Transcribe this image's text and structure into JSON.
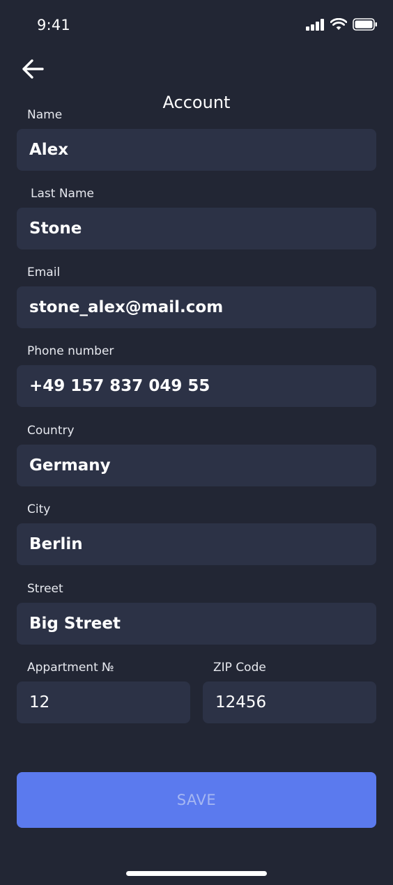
{
  "status_bar": {
    "time": "9:41"
  },
  "header": {
    "title": "Account"
  },
  "form": {
    "name": {
      "label": "Name",
      "value": "Alex"
    },
    "last_name": {
      "label": "Last Name",
      "value": "Stone"
    },
    "email": {
      "label": "Email",
      "value": "stone_alex@mail.com"
    },
    "phone": {
      "label": "Phone number",
      "value": "+49 157 837 049 55"
    },
    "country": {
      "label": "Country",
      "value": "Germany"
    },
    "city": {
      "label": "City",
      "value": "Berlin"
    },
    "street": {
      "label": "Street",
      "value": "Big Street"
    },
    "apartment": {
      "label": "Appartment №",
      "value": "12"
    },
    "zip": {
      "label": "ZIP Code",
      "value": "12456"
    }
  },
  "actions": {
    "save_label": "SAVE"
  },
  "icons": {
    "back": "arrow-left-icon",
    "signal": "cellular-signal-icon",
    "wifi": "wifi-icon",
    "battery": "battery-icon"
  },
  "colors": {
    "background": "#222634",
    "field_background": "#2c3246",
    "save_button": "#5b7aee",
    "save_label": "#a6b7f2"
  }
}
